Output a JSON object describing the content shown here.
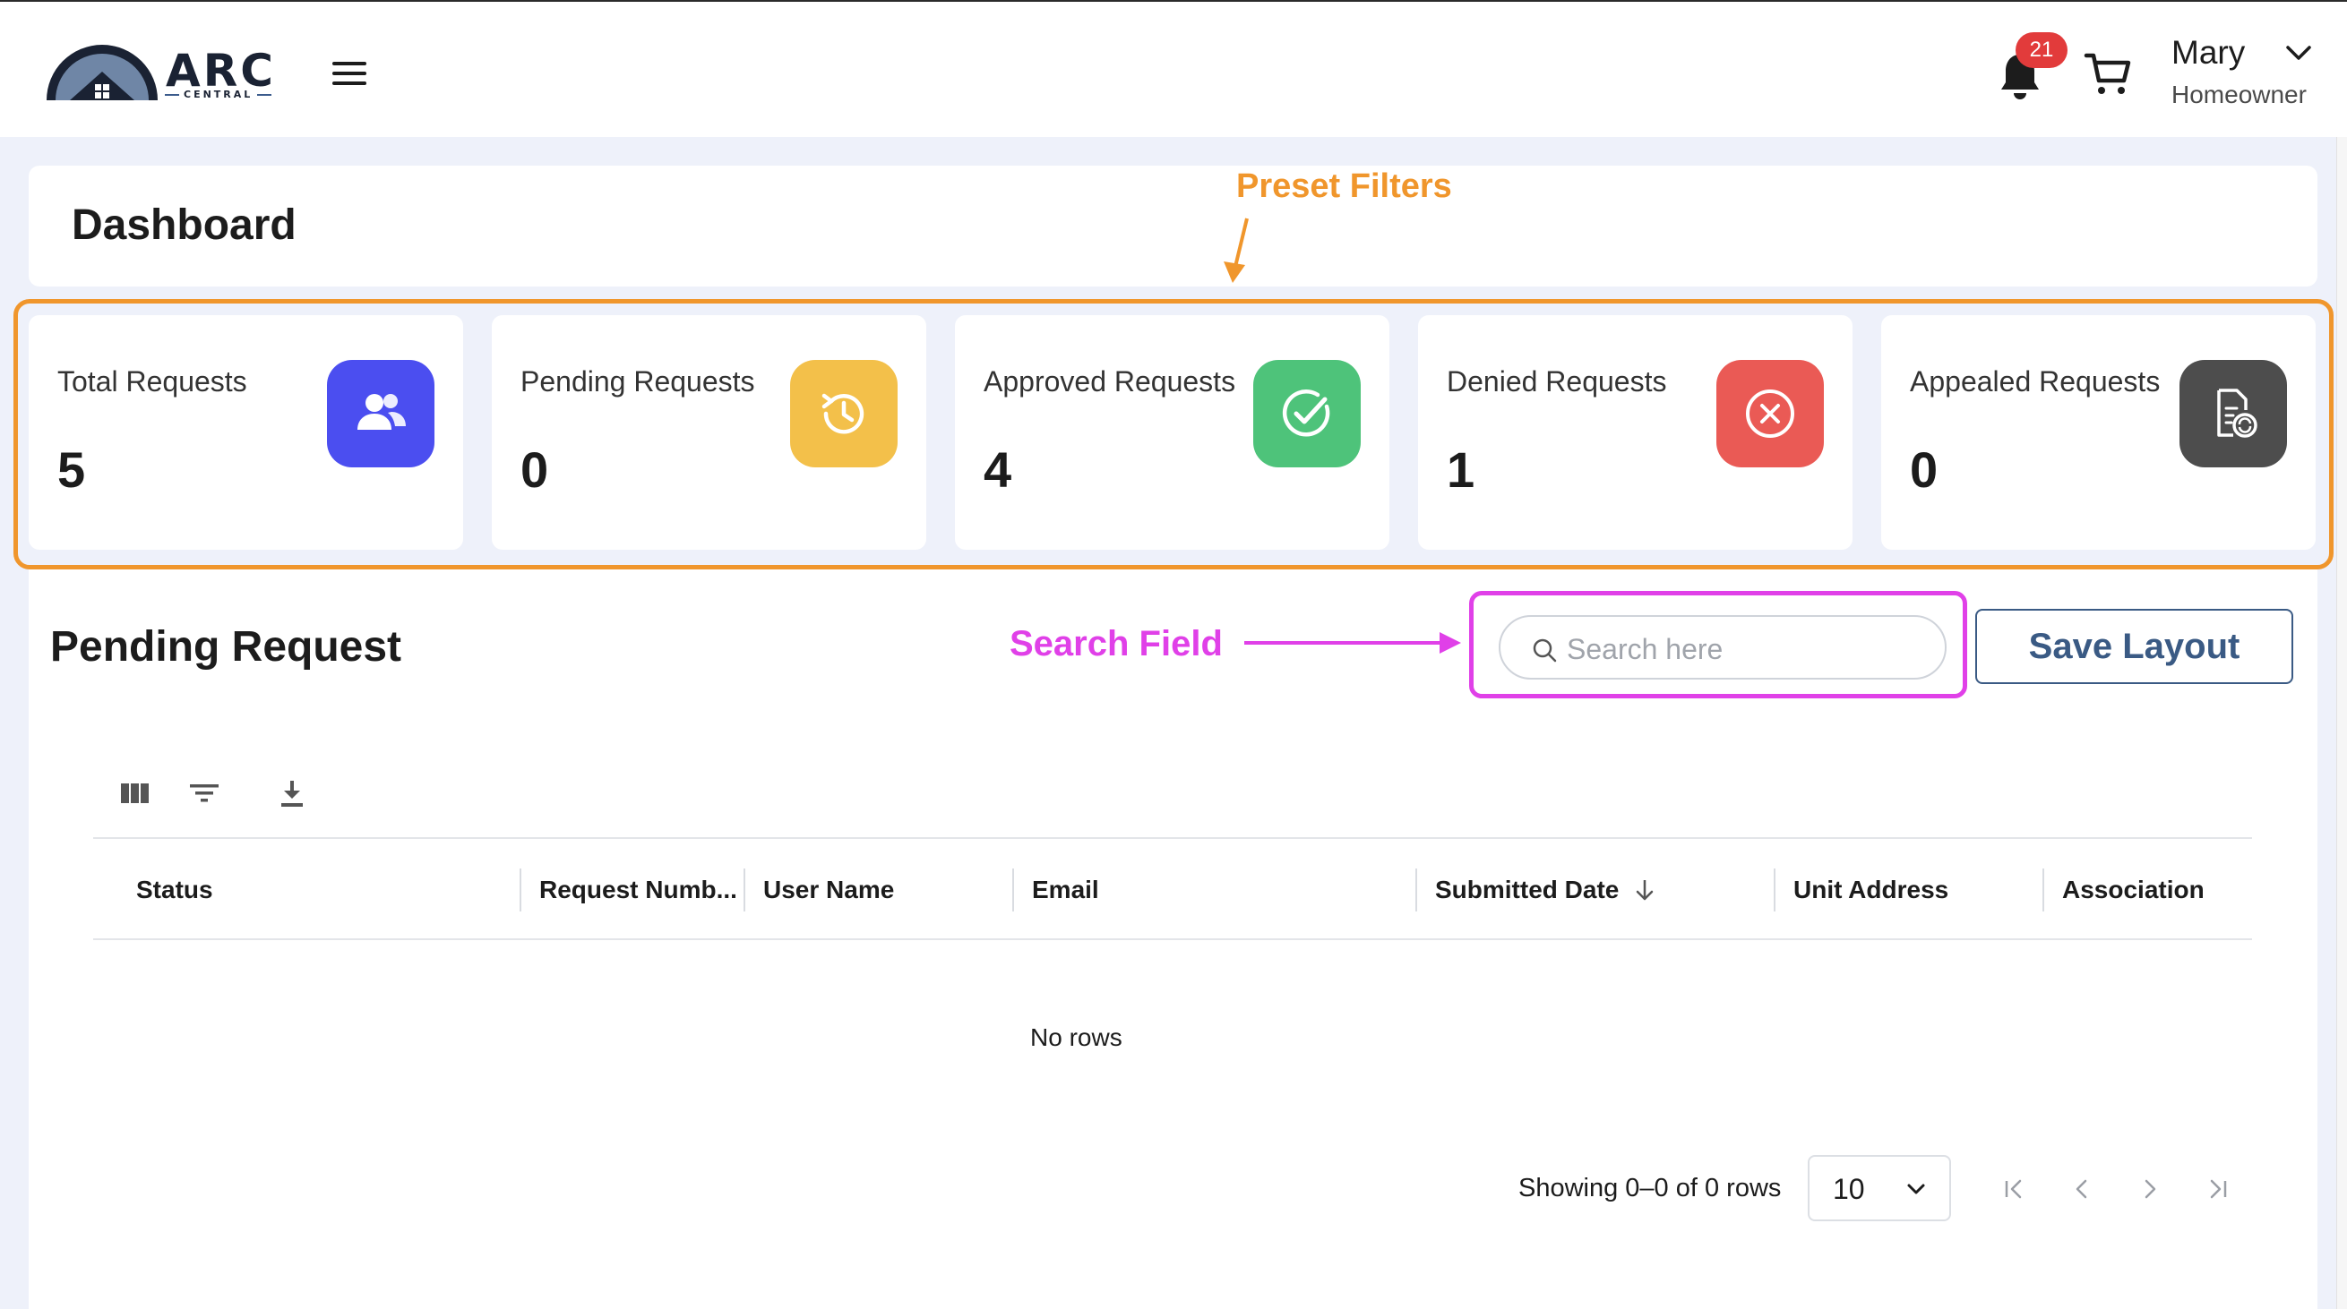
{
  "header": {
    "logo_text": "ARC",
    "logo_subtext": "CENTRAL",
    "notification_count": "21",
    "user_name": "Mary",
    "user_role": "Homeowner"
  },
  "page_title": "Dashboard",
  "annotations": {
    "preset_filters": "Preset Filters",
    "search_field": "Search Field",
    "color_preset": "#f0962c",
    "color_search": "#e040e8"
  },
  "stats": [
    {
      "label": "Total Requests",
      "value": "5",
      "icon": "users-icon",
      "color": "#4b4ef0"
    },
    {
      "label": "Pending Requests",
      "value": "0",
      "icon": "clock-history-icon",
      "color": "#f3c04a"
    },
    {
      "label": "Approved Requests",
      "value": "4",
      "icon": "check-circle-icon",
      "color": "#4ec37a"
    },
    {
      "label": "Denied Requests",
      "value": "1",
      "icon": "x-circle-icon",
      "color": "#ea5a55"
    },
    {
      "label": "Appealed Requests",
      "value": "0",
      "icon": "document-refresh-icon",
      "color": "#4d4d4d"
    }
  ],
  "pending": {
    "title": "Pending Request",
    "search_placeholder": "Search here",
    "save_layout_label": "Save Layout",
    "toolbar_icons": [
      "columns-icon",
      "filter-icon",
      "download-icon"
    ],
    "columns": [
      "Status",
      "Request Numb...",
      "User Name",
      "Email",
      "Submitted Date",
      "Unit Address",
      "Association"
    ],
    "sorted_column": "Submitted Date",
    "empty_text": "No rows",
    "showing_text": "Showing 0–0 of 0 rows",
    "page_size": "10"
  }
}
